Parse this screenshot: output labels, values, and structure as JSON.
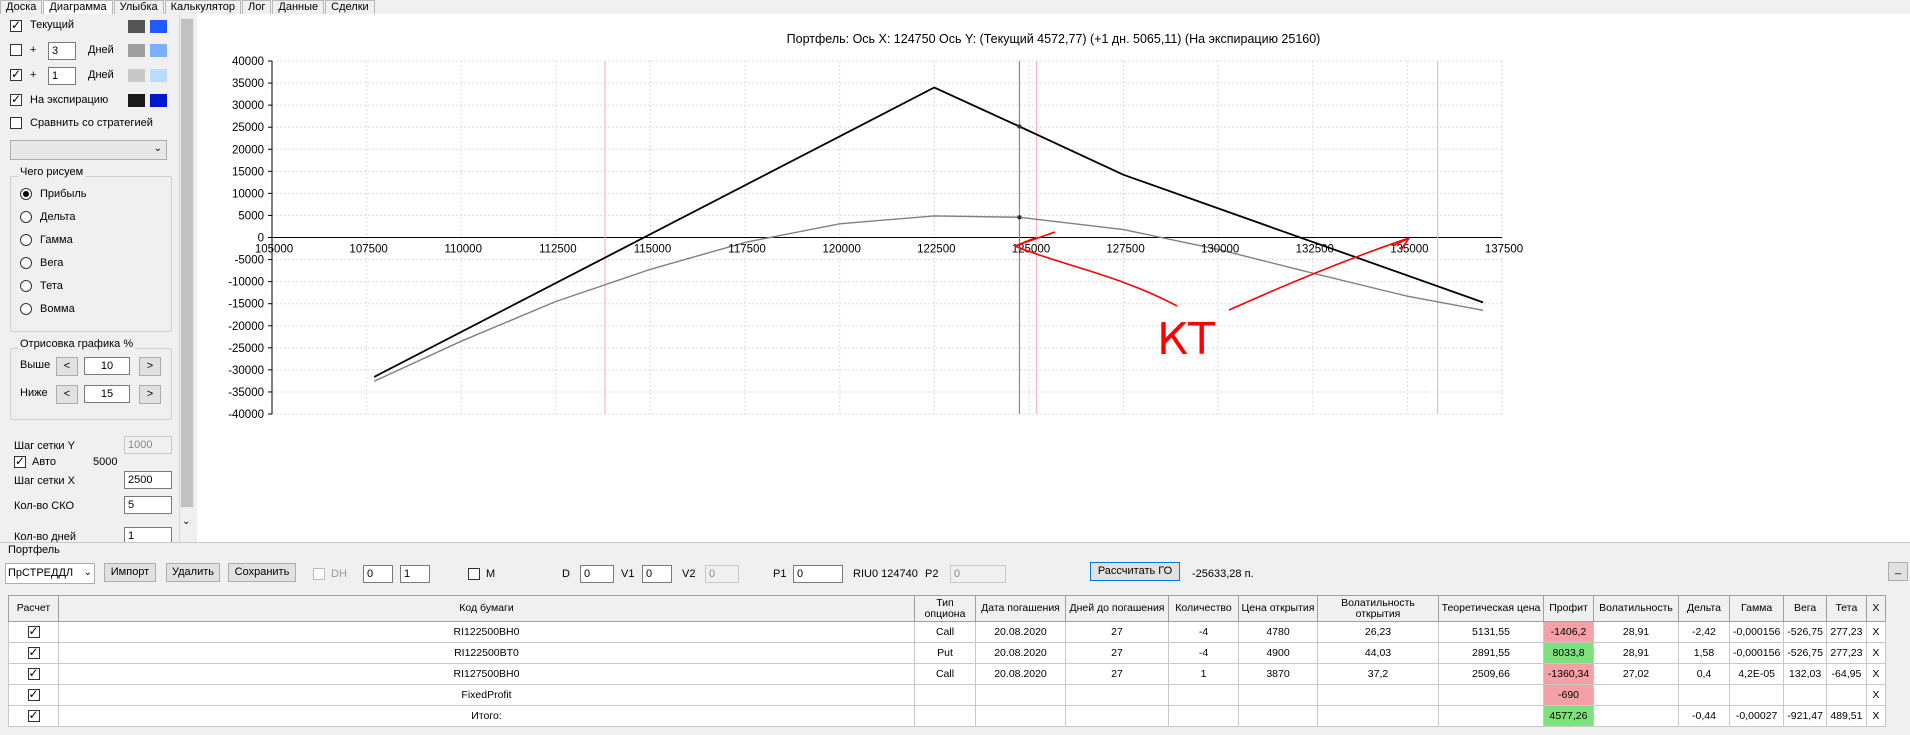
{
  "tabs": [
    {
      "label": "Доска"
    },
    {
      "label": "Диаграмма"
    },
    {
      "label": "Улыбка"
    },
    {
      "label": "Калькулятор"
    },
    {
      "label": "Лог"
    },
    {
      "label": "Данные"
    },
    {
      "label": "Сделки"
    }
  ],
  "sidebar": {
    "current_label": "Текущий",
    "plus": "+",
    "days1_value": "3",
    "days2_value": "1",
    "days_label": "Дней",
    "expiry_label": "На экспирацию",
    "compare_label": "Сравнить со стратегией",
    "draw_group_title": "Чего рисуем",
    "radios": [
      "Прибыль",
      "Дельта",
      "Гамма",
      "Вега",
      "Тета",
      "Вомма"
    ],
    "render_group_title": "Отрисовка графика %",
    "above_label": "Выше",
    "below_label": "Ниже",
    "above_value": "10",
    "below_value": "15",
    "dec": "<",
    "inc": ">",
    "grid_y_label": "Шаг сетки Y",
    "grid_y_value": "1000",
    "auto_label": "Авто",
    "auto_value": "5000",
    "grid_x_label": "Шаг сетки X",
    "grid_x_value": "2500",
    "sko_label": "Кол-во СКО",
    "sko_value": "5",
    "days_count_label": "Кол-во дней",
    "days_count_value": "1",
    "swatch_colors": {
      "current": [
        "#555555",
        "#1f5cff"
      ],
      "plus3": [
        "#9e9e9e",
        "#7ab0ff"
      ],
      "plus1": [
        "#c8c8c8",
        "#b9dcff"
      ],
      "expiry": [
        "#1a1a1a",
        "#0018c8"
      ]
    }
  },
  "chart_title": "Портфель: Ось X:  124750 Ось Y:   (Текущий 4572,77)   (+1 дн. 5065,11)   (На экспирацию 25160)",
  "annotation": "КТ",
  "chart_data": {
    "type": "line",
    "xlim": [
      105000,
      137500
    ],
    "ylim": [
      -40000,
      40000
    ],
    "x_ticks": [
      105000,
      107500,
      110000,
      112500,
      115000,
      117500,
      120000,
      122500,
      125000,
      127500,
      130000,
      132500,
      135000,
      137500
    ],
    "y_ticks": [
      40000,
      35000,
      30000,
      25000,
      20000,
      15000,
      10000,
      5000,
      0,
      -5000,
      -10000,
      -15000,
      -20000,
      -25000,
      -30000,
      -35000,
      -40000
    ],
    "series": [
      {
        "color": "#000000",
        "points": [
          [
            107700,
            -31600
          ],
          [
            122500,
            34000
          ],
          [
            124750,
            25160
          ],
          [
            127500,
            14200
          ],
          [
            137000,
            -14700
          ]
        ]
      },
      {
        "color": "#808080",
        "points": [
          [
            107700,
            -32600
          ],
          [
            110000,
            -23500
          ],
          [
            112500,
            -14500
          ],
          [
            115000,
            -7200
          ],
          [
            117500,
            -1100
          ],
          [
            120000,
            3100
          ],
          [
            122500,
            4900
          ],
          [
            124750,
            4573
          ],
          [
            127500,
            1800
          ],
          [
            130000,
            -2700
          ],
          [
            132500,
            -8100
          ],
          [
            135000,
            -13300
          ],
          [
            137000,
            -16500
          ]
        ]
      }
    ],
    "vertical_lines": [
      {
        "x": 113800,
        "color": "#f7b5bd"
      },
      {
        "x": 124750,
        "color": "#7a8aa8"
      },
      {
        "x": 125200,
        "color": "#f7b5bd"
      },
      {
        "x": 135800,
        "color": "#f7b5bd"
      }
    ],
    "markers": [
      [
        124750,
        25160
      ],
      [
        124750,
        4573
      ]
    ],
    "grid": true
  },
  "portfolio": {
    "title": "Портфель",
    "strategy_select": "ПрСТРЕДДЛ",
    "import": "Импорт",
    "delete": "Удалить",
    "save": "Сохранить",
    "dh": "DH",
    "spin1": "0",
    "spin2": "1",
    "m": "M",
    "d_label": "D",
    "d_value": "0",
    "v1_label": "V1",
    "v1_value": "0",
    "v2_label": "V2",
    "v2_value": "0",
    "p1_label": "P1",
    "p1_value": "0",
    "riu": "RIU0 124740",
    "p2_label": "P2",
    "p2_value": "0",
    "calc_go": "Рассчитать ГО",
    "go_value": "-25633,28 п.",
    "minimize": "_"
  },
  "table": {
    "headers": [
      "Расчет",
      "Код бумаги",
      "Тип опциона",
      "Дата погашения",
      "Дней до погашения",
      "Количество",
      "Цена открытия",
      "Волатильность открытия",
      "Теоретическая цена",
      "Профит",
      "Волатильность",
      "Дельта",
      "Гамма",
      "Вега",
      "Тета",
      "X"
    ],
    "rows": [
      {
        "code": "RI122500BH0",
        "type": "Call",
        "date": "20.08.2020",
        "days": "27",
        "qty": "-4",
        "price": "4780",
        "vol_open": "26,23",
        "theo": "5131,55",
        "profit": "-1406,2",
        "profit_color": "red",
        "vol": "28,91",
        "delta": "-2,42",
        "gamma": "-0,000156",
        "vega": "-526,75",
        "theta": "277,23",
        "x": "X"
      },
      {
        "code": "RI122500BT0",
        "type": "Put",
        "date": "20.08.2020",
        "days": "27",
        "qty": "-4",
        "price": "4900",
        "vol_open": "44,03",
        "theo": "2891,55",
        "profit": "8033,8",
        "profit_color": "green",
        "vol": "28,91",
        "delta": "1,58",
        "gamma": "-0,000156",
        "vega": "-526,75",
        "theta": "277,23",
        "x": "X"
      },
      {
        "code": "RI127500BH0",
        "type": "Call",
        "date": "20.08.2020",
        "days": "27",
        "qty": "1",
        "price": "3870",
        "vol_open": "37,2",
        "theo": "2509,66",
        "profit": "-1360,34",
        "profit_color": "red",
        "vol": "27,02",
        "delta": "0,4",
        "gamma": "4,2E-05",
        "vega": "132,03",
        "theta": "-64,95",
        "x": "X"
      },
      {
        "code": "FixedProfit",
        "type": "",
        "date": "",
        "days": "",
        "qty": "",
        "price": "",
        "vol_open": "",
        "theo": "",
        "profit": "-690",
        "profit_color": "red",
        "vol": "",
        "delta": "",
        "gamma": "",
        "vega": "",
        "theta": "",
        "x": "X"
      },
      {
        "code": "Итого:",
        "type": "",
        "date": "",
        "days": "",
        "qty": "",
        "price": "",
        "vol_open": "",
        "theo": "",
        "profit": "4577,26",
        "profit_color": "green",
        "vol": "",
        "delta": "-0,44",
        "gamma": "-0,00027",
        "vega": "-921,47",
        "theta": "489,51",
        "x": "X"
      }
    ]
  }
}
